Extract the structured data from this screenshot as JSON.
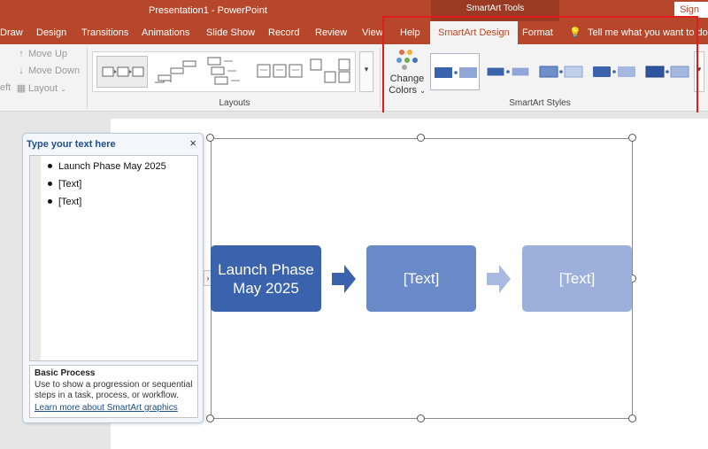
{
  "titlebar": {
    "title": "Presentation1  -  PowerPoint",
    "context_tools": "SmartArt Tools",
    "signin": "Sign in"
  },
  "tabs": [
    {
      "label": "Draw"
    },
    {
      "label": "Design"
    },
    {
      "label": "Transitions"
    },
    {
      "label": "Animations"
    },
    {
      "label": "Slide Show"
    },
    {
      "label": "Record"
    },
    {
      "label": "Review"
    },
    {
      "label": "View"
    },
    {
      "label": "Help"
    },
    {
      "label": "SmartArt Design"
    },
    {
      "label": "Format"
    }
  ],
  "tellme": {
    "text": "Tell me what you want to do"
  },
  "ribbon": {
    "create_graphic": {
      "move_up": "Move Up",
      "move_down": "Move Down",
      "left_fragment": "eft",
      "layout": "Layout"
    },
    "layouts_label": "Layouts",
    "change_colors_line1": "Change",
    "change_colors_line2": "Colors",
    "styles_label": "SmartArt Styles"
  },
  "text_pane": {
    "title": "Type your text here",
    "close": "×",
    "bullets": [
      "Launch Phase May 2025",
      "[Text]",
      "[Text]"
    ],
    "desc_title": "Basic Process",
    "desc_text": "Use to show a progression or sequential steps in a task, process, or workflow.",
    "desc_link": "Learn more about SmartArt graphics",
    "expander": "›"
  },
  "smartart": {
    "shapes": [
      "Launch Phase May 2025",
      "[Text]",
      "[Text]"
    ],
    "colors": [
      "#3b62ad",
      "#6a89c9",
      "#9db0dc"
    ]
  },
  "colors": {
    "accent": "#b7472a",
    "highlight": "#e21b1b"
  }
}
